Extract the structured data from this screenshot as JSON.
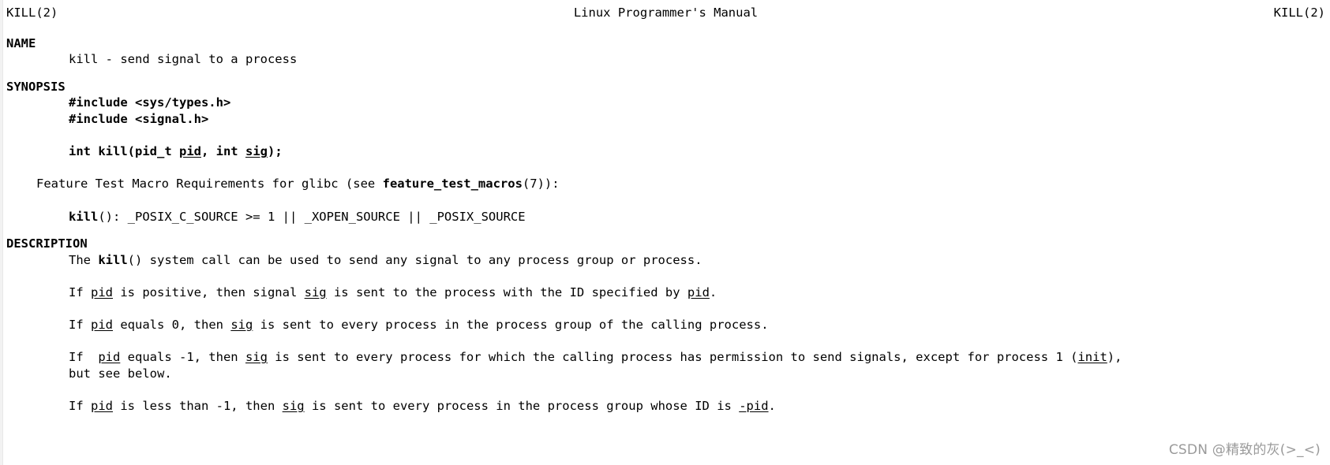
{
  "header": {
    "left": "KILL(2)",
    "center": "Linux Programmer's Manual",
    "right": "KILL(2)"
  },
  "sections": {
    "name": {
      "title": "NAME",
      "body": "kill - send signal to a process"
    },
    "synopsis": {
      "title": "SYNOPSIS",
      "include_types": "#include <sys/types.h>",
      "include_signal": "#include <signal.h>",
      "prototype": {
        "pre": "int kill(pid_t ",
        "arg1": "pid",
        "mid": ", int ",
        "arg2": "sig",
        "post": ");"
      },
      "feature_macro_line": {
        "pre": "Feature Test Macro Requirements for glibc (see ",
        "bold": "feature_test_macros",
        "post": "(7)):"
      },
      "posix_line": {
        "bold": "kill",
        "rest": "(): _POSIX_C_SOURCE >= 1 || _XOPEN_SOURCE || _POSIX_SOURCE"
      }
    },
    "description": {
      "title": "DESCRIPTION",
      "para1": {
        "pre": "The ",
        "bold": "kill",
        "post": "() system call can be used to send any signal to any process group or process."
      },
      "para2": {
        "s1": "If ",
        "u1": "pid",
        "s2": " is positive, then signal ",
        "u2": "sig",
        "s3": " is sent to the process with the ID specified by ",
        "u3": "pid",
        "s4": "."
      },
      "para3": {
        "s1": "If ",
        "u1": "pid",
        "s2": " equals 0, then ",
        "u2": "sig",
        "s3": " is sent to every process in the process group of the calling process."
      },
      "para4": {
        "s1": "If  ",
        "u1": "pid",
        "s2": " equals -1, then ",
        "u2": "sig",
        "s3": " is sent to every process for which the calling process has permission to send signals, except for process 1 (",
        "u3": "init",
        "s4": "),",
        "line2": "but see below."
      },
      "para5": {
        "s1": "If ",
        "u1": "pid",
        "s2": " is less than -1, then ",
        "u2": "sig",
        "s3": " is sent to every process in the process group whose ID is ",
        "u3": "-pid",
        "s4": "."
      }
    }
  },
  "watermark": {
    "brand": "CSDN @",
    "user": "精致的灰(>_<)"
  }
}
